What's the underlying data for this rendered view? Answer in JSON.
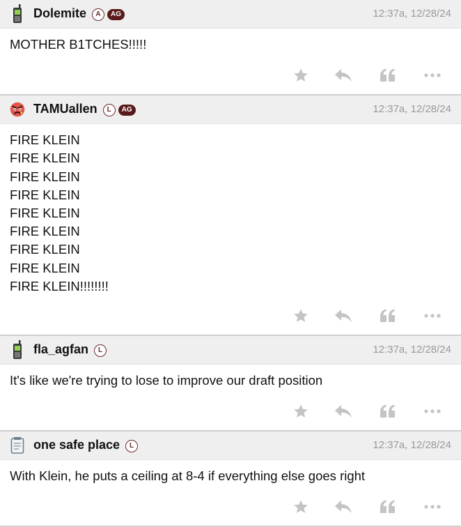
{
  "posts": [
    {
      "username": "Dolemite",
      "avatar_icon": "phone-icon",
      "badges": [
        "A",
        "AG"
      ],
      "timestamp": "12:37a, 12/28/24",
      "lines": [
        "MOTHER B1TCHES!!!!!"
      ]
    },
    {
      "username": "TAMUallen",
      "avatar_icon": "angry-face-icon",
      "badges": [
        "L",
        "AG"
      ],
      "timestamp": "12:37a, 12/28/24",
      "lines": [
        "FIRE KLEIN",
        "FIRE KLEIN",
        "FIRE KLEIN",
        "FIRE KLEIN",
        "FIRE KLEIN",
        "FIRE KLEIN",
        "FIRE KLEIN",
        "FIRE KLEIN",
        "FIRE KLEIN!!!!!!!!"
      ]
    },
    {
      "username": "fla_agfan",
      "avatar_icon": "phone-icon",
      "badges": [
        "L"
      ],
      "timestamp": "12:37a, 12/28/24",
      "lines": [
        "It's like we're trying to lose to improve our draft position"
      ]
    },
    {
      "username": "one safe place",
      "avatar_icon": "notepad-icon",
      "badges": [
        "L"
      ],
      "timestamp": "12:37a, 12/28/24",
      "lines": [
        "With Klein, he puts a ceiling at 8-4 if everything else goes right"
      ]
    }
  ],
  "action_icons": [
    "star-icon",
    "reply-icon",
    "quote-icon",
    "more-icon"
  ],
  "colors": {
    "header_bg": "#efefef",
    "badge_ag": "#5a1a1a",
    "badge_border": "#6b2b2b",
    "timestamp": "#9a9a9a",
    "icon": "#c4c4c4"
  }
}
